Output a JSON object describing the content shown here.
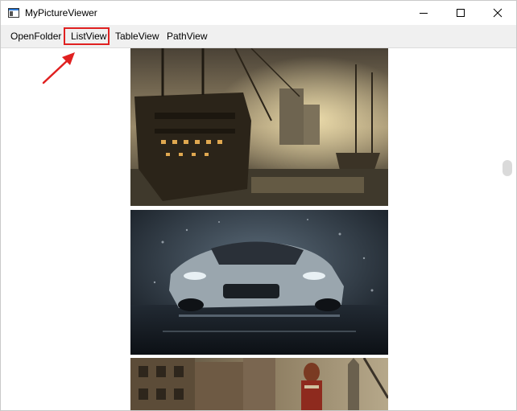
{
  "window": {
    "title": "MyPictureViewer",
    "app_icon": "window-app-icon",
    "controls": [
      "minimize-icon",
      "maximize-icon",
      "close-icon"
    ]
  },
  "menu": {
    "items": [
      {
        "label": "OpenFolder"
      },
      {
        "label": "ListView"
      },
      {
        "label": "TableView"
      },
      {
        "label": "PathView"
      }
    ],
    "highlighted": "ListView"
  },
  "annotation": {
    "color": "#e02020"
  },
  "images": [
    {
      "subject": "pirate-ship-painting"
    },
    {
      "subject": "silver-sports-car-in-rain"
    },
    {
      "subject": "post-apocalyptic-city-with-woman"
    }
  ]
}
